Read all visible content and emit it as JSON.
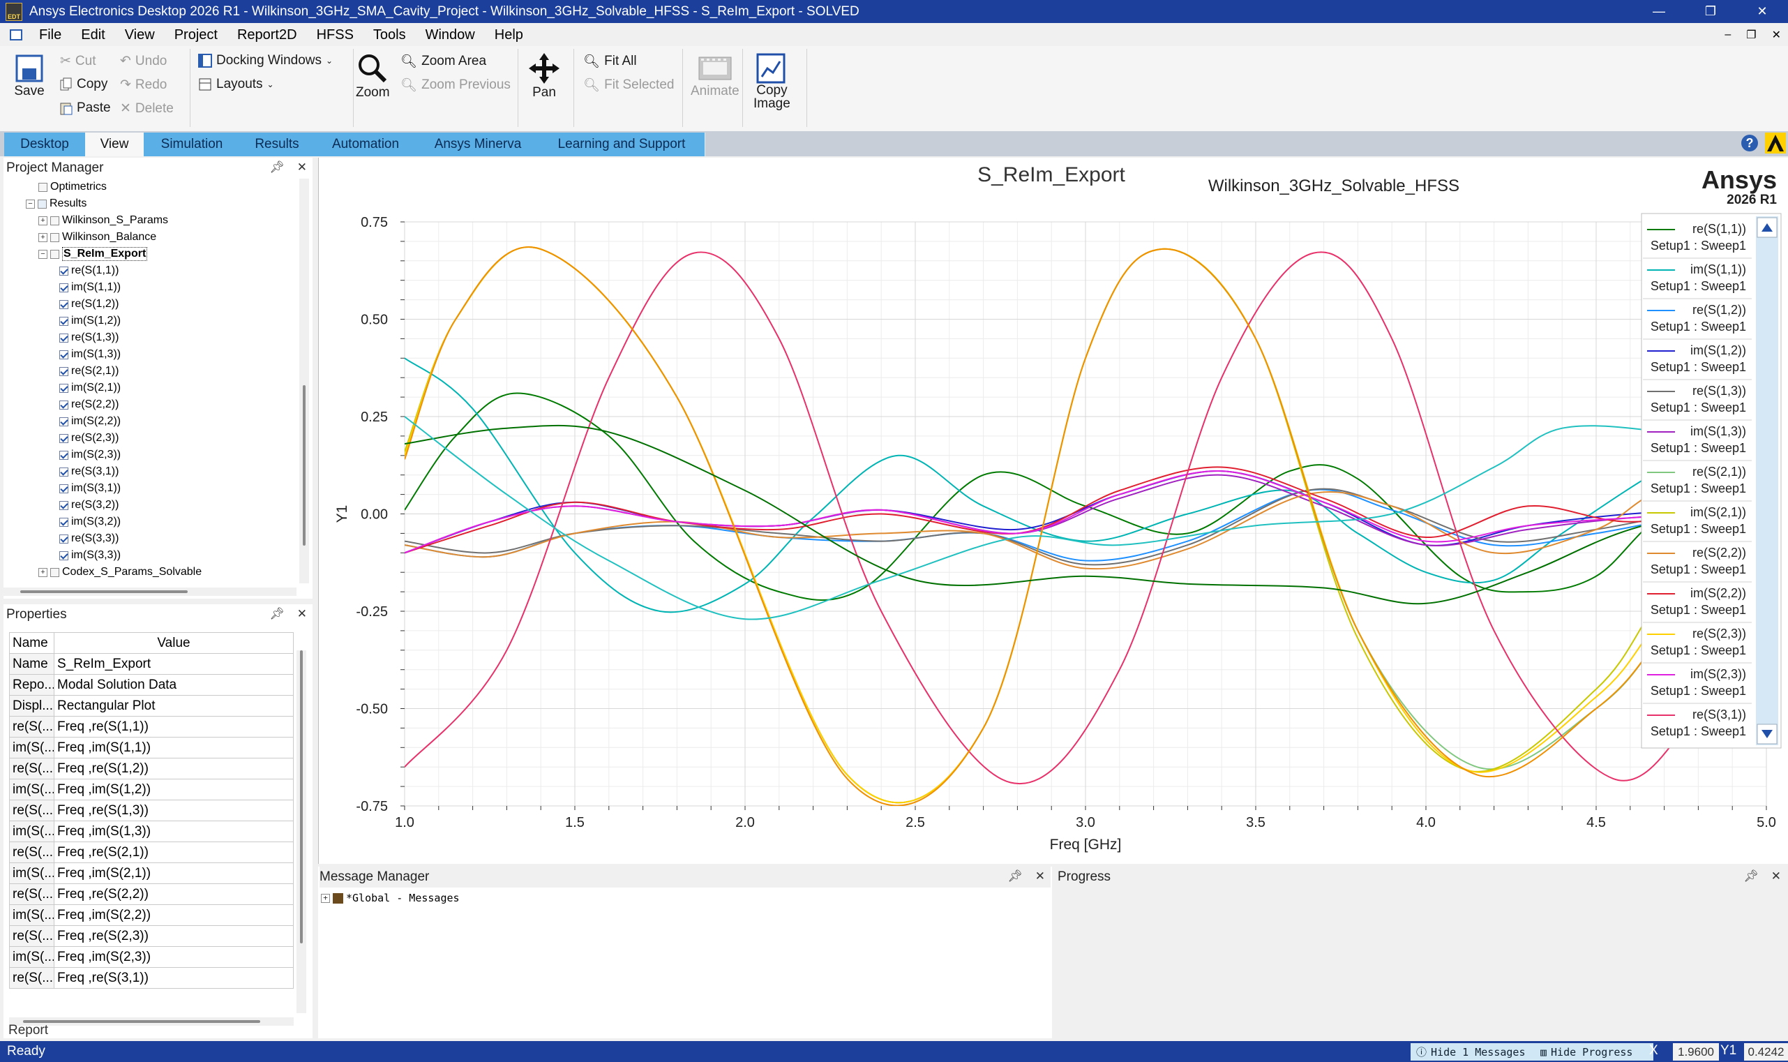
{
  "window": {
    "title": "Ansys Electronics Desktop 2026 R1 - Wilkinson_3GHz_SMA_Cavity_Project - Wilkinson_3GHz_Solvable_HFSS - S_ReIm_Export - SOLVED",
    "app_icon_text": "EDT",
    "controls": [
      "—",
      "❐",
      "✕"
    ]
  },
  "menu": {
    "items": [
      "File",
      "Edit",
      "View",
      "Project",
      "Report2D",
      "HFSS",
      "Tools",
      "Window",
      "Help"
    ],
    "mdi_controls": [
      "–",
      "❐",
      "✕"
    ]
  },
  "ribbon": {
    "save": "Save",
    "cut": "Cut",
    "copy": "Copy",
    "paste": "Paste",
    "undo": "Undo",
    "redo": "Redo",
    "delete": "Delete",
    "docking_windows": "Docking Windows",
    "layouts": "Layouts",
    "zoom": "Zoom",
    "zoom_area": "Zoom Area",
    "zoom_previous": "Zoom Previous",
    "pan": "Pan",
    "fit_all": "Fit All",
    "fit_selected": "Fit Selected",
    "animate": "Animate",
    "copy_image_line1": "Copy",
    "copy_image_line2": "Image"
  },
  "tabs": [
    "Desktop",
    "View",
    "Simulation",
    "Results",
    "Automation",
    "Ansys Minerva",
    "Learning and Support"
  ],
  "active_tab": "View",
  "project_manager": {
    "title": "Project Manager",
    "tree": [
      {
        "label": "Optimetrics",
        "level": 3,
        "exp": "",
        "icon": "optimetrics"
      },
      {
        "label": "Results",
        "level": 2,
        "exp": "−",
        "icon": "results"
      },
      {
        "label": "Wilkinson_S_Params",
        "level": 3,
        "exp": "+",
        "icon": "report"
      },
      {
        "label": "Wilkinson_Balance",
        "level": 3,
        "exp": "+",
        "icon": "report"
      },
      {
        "label": "S_ReIm_Export",
        "level": 3,
        "exp": "−",
        "icon": "report",
        "bold": true
      },
      {
        "label": "re(S(1,1))",
        "level": 4,
        "icon": "check"
      },
      {
        "label": "im(S(1,1))",
        "level": 4,
        "icon": "check"
      },
      {
        "label": "re(S(1,2))",
        "level": 4,
        "icon": "check"
      },
      {
        "label": "im(S(1,2))",
        "level": 4,
        "icon": "check"
      },
      {
        "label": "re(S(1,3))",
        "level": 4,
        "icon": "check"
      },
      {
        "label": "im(S(1,3))",
        "level": 4,
        "icon": "check"
      },
      {
        "label": "re(S(2,1))",
        "level": 4,
        "icon": "check"
      },
      {
        "label": "im(S(2,1))",
        "level": 4,
        "icon": "check"
      },
      {
        "label": "re(S(2,2))",
        "level": 4,
        "icon": "check"
      },
      {
        "label": "im(S(2,2))",
        "level": 4,
        "icon": "check"
      },
      {
        "label": "re(S(2,3))",
        "level": 4,
        "icon": "check"
      },
      {
        "label": "im(S(2,3))",
        "level": 4,
        "icon": "check"
      },
      {
        "label": "re(S(3,1))",
        "level": 4,
        "icon": "check"
      },
      {
        "label": "im(S(3,1))",
        "level": 4,
        "icon": "check"
      },
      {
        "label": "re(S(3,2))",
        "level": 4,
        "icon": "check"
      },
      {
        "label": "im(S(3,2))",
        "level": 4,
        "icon": "check"
      },
      {
        "label": "re(S(3,3))",
        "level": 4,
        "icon": "check"
      },
      {
        "label": "im(S(3,3))",
        "level": 4,
        "icon": "check"
      },
      {
        "label": "Codex_S_Params_Solvable",
        "level": 3,
        "exp": "+",
        "icon": "report"
      }
    ]
  },
  "properties": {
    "title": "Properties",
    "col_name": "Name",
    "col_value": "Value",
    "rows": [
      {
        "name": "Name",
        "value": "S_ReIm_Export"
      },
      {
        "name": "Repo...",
        "value": "Modal Solution Data"
      },
      {
        "name": "Displ...",
        "value": "Rectangular Plot"
      },
      {
        "name": "re(S(...",
        "value": "Freq ,re(S(1,1))"
      },
      {
        "name": "im(S(...",
        "value": "Freq ,im(S(1,1))"
      },
      {
        "name": "re(S(...",
        "value": "Freq ,re(S(1,2))"
      },
      {
        "name": "im(S(...",
        "value": "Freq ,im(S(1,2))"
      },
      {
        "name": "re(S(...",
        "value": "Freq ,re(S(1,3))"
      },
      {
        "name": "im(S(...",
        "value": "Freq ,im(S(1,3))"
      },
      {
        "name": "re(S(...",
        "value": "Freq ,re(S(2,1))"
      },
      {
        "name": "im(S(...",
        "value": "Freq ,im(S(2,1))"
      },
      {
        "name": "re(S(...",
        "value": "Freq ,re(S(2,2))"
      },
      {
        "name": "im(S(...",
        "value": "Freq ,im(S(2,2))"
      },
      {
        "name": "re(S(...",
        "value": "Freq ,re(S(2,3))"
      },
      {
        "name": "im(S(...",
        "value": "Freq ,im(S(2,3))"
      },
      {
        "name": "re(S(...",
        "value": "Freq ,re(S(3,1))"
      }
    ],
    "report_tab": "Report"
  },
  "chart_data": {
    "type": "line",
    "title": "S_ReIm_Export",
    "design_label": "Wilkinson_3GHz_Solvable_HFSS",
    "brand": "Ansys",
    "brand_version": "2026 R1",
    "xlabel": "Freq [GHz]",
    "ylabel": "Y1",
    "xlim": [
      1.0,
      5.0
    ],
    "ylim": [
      -0.75,
      0.75
    ],
    "xticks": [
      1.0,
      1.5,
      2.0,
      2.5,
      3.0,
      3.5,
      4.0,
      4.5,
      5.0
    ],
    "xtick_labels": [
      "1.0",
      "1.5",
      "2.0",
      "2.5",
      "3.0",
      "3.5",
      "4.0",
      "4.5",
      "5.0"
    ],
    "yticks": [
      0.75,
      0.5,
      0.25,
      0.0,
      -0.25,
      -0.5,
      -0.75
    ],
    "ytick_labels": [
      "0.75",
      "0.50",
      "0.25",
      "0.00",
      "-0.25",
      "-0.50",
      "-0.75"
    ],
    "grid": true,
    "legend_position": "right",
    "legend_sweep_label": "Setup1 : Sweep1",
    "series": [
      {
        "name": "re(S(1,1))",
        "color": "#007a00",
        "x": [
          1.0,
          1.15,
          1.33,
          1.6,
          1.85,
          2.1,
          2.35,
          2.7,
          3.0,
          3.3,
          3.6,
          3.8,
          4.1,
          4.3,
          4.5,
          4.7,
          5.0
        ],
        "y": [
          0.01,
          0.2,
          0.31,
          0.2,
          -0.07,
          -0.2,
          -0.19,
          0.1,
          0.02,
          -0.05,
          0.11,
          0.09,
          -0.16,
          -0.2,
          -0.16,
          0.0,
          0.1
        ]
      },
      {
        "name": "im(S(1,1))",
        "color": "#00b4b4",
        "x": [
          1.0,
          1.2,
          1.5,
          1.75,
          2.0,
          2.2,
          2.45,
          2.7,
          3.0,
          3.3,
          3.6,
          3.8,
          4.0,
          4.2,
          4.4,
          4.7,
          5.0
        ],
        "y": [
          0.4,
          0.27,
          -0.1,
          -0.25,
          -0.18,
          -0.01,
          0.15,
          0.02,
          -0.07,
          0.0,
          0.06,
          -0.05,
          -0.15,
          -0.17,
          -0.05,
          0.12,
          0.25
        ]
      },
      {
        "name": "re(S(1,2))",
        "color": "#1e90ff",
        "x": [
          1.0,
          1.25,
          1.5,
          1.8,
          2.1,
          2.4,
          2.7,
          3.0,
          3.3,
          3.65,
          3.9,
          4.2,
          4.5,
          4.8,
          5.0
        ],
        "y": [
          -0.08,
          -0.11,
          -0.05,
          -0.03,
          -0.06,
          -0.07,
          -0.05,
          -0.12,
          -0.07,
          0.06,
          0.01,
          -0.08,
          -0.05,
          0.0,
          0.02
        ]
      },
      {
        "name": "im(S(1,2))",
        "color": "#2020d0",
        "x": [
          1.0,
          1.25,
          1.5,
          1.8,
          2.1,
          2.4,
          2.8,
          3.1,
          3.4,
          3.7,
          4.0,
          4.3,
          4.6,
          5.0
        ],
        "y": [
          -0.1,
          -0.02,
          0.03,
          -0.02,
          -0.03,
          0.01,
          -0.04,
          0.05,
          0.11,
          0.03,
          -0.08,
          -0.03,
          0.0,
          0.02
        ]
      },
      {
        "name": "re(S(1,3))",
        "color": "#707070",
        "x": [
          1.0,
          1.25,
          1.5,
          1.8,
          2.1,
          2.4,
          2.7,
          3.0,
          3.3,
          3.65,
          3.9,
          4.2,
          4.5,
          4.8,
          5.0
        ],
        "y": [
          -0.07,
          -0.1,
          -0.05,
          -0.03,
          -0.05,
          -0.07,
          -0.05,
          -0.13,
          -0.08,
          0.06,
          0.02,
          -0.07,
          -0.04,
          0.01,
          0.03
        ]
      },
      {
        "name": "im(S(1,3))",
        "color": "#a020c0",
        "x": [
          1.0,
          1.25,
          1.5,
          1.8,
          2.1,
          2.4,
          2.8,
          3.1,
          3.4,
          3.7,
          4.0,
          4.3,
          4.6,
          5.0
        ],
        "y": [
          -0.1,
          -0.02,
          0.02,
          -0.02,
          -0.03,
          0.01,
          -0.05,
          0.04,
          0.1,
          0.02,
          -0.08,
          -0.04,
          -0.01,
          0.01
        ]
      },
      {
        "name": "re(S(2,1))",
        "color": "#80c880",
        "x": [
          1.0,
          1.15,
          1.4,
          1.8,
          2.3,
          2.7,
          3.0,
          3.22,
          3.5,
          3.8,
          4.15,
          4.5,
          4.7,
          5.0
        ],
        "y": [
          0.15,
          0.5,
          0.68,
          0.3,
          -0.67,
          -0.55,
          0.4,
          0.68,
          0.45,
          -0.3,
          -0.65,
          -0.5,
          -0.3,
          0.1
        ]
      },
      {
        "name": "im(S(2,1))",
        "color": "#c8c800",
        "x": [
          1.0,
          1.15,
          1.4,
          1.8,
          2.3,
          2.7,
          3.0,
          3.22,
          3.5,
          3.8,
          4.13,
          4.5,
          4.7,
          5.0
        ],
        "y": [
          0.16,
          0.5,
          0.68,
          0.3,
          -0.67,
          -0.55,
          0.4,
          0.68,
          0.45,
          -0.32,
          -0.66,
          -0.45,
          -0.2,
          0.15
        ]
      },
      {
        "name": "re(S(2,2))",
        "color": "#e08a30",
        "x": [
          1.0,
          1.25,
          1.5,
          1.8,
          2.1,
          2.4,
          2.7,
          3.0,
          3.3,
          3.65,
          3.9,
          4.2,
          4.5,
          4.7,
          5.0
        ],
        "y": [
          -0.08,
          -0.11,
          -0.05,
          -0.02,
          -0.06,
          -0.05,
          -0.05,
          -0.14,
          -0.09,
          0.05,
          0.02,
          -0.1,
          -0.04,
          0.06,
          0.05
        ]
      },
      {
        "name": "im(S(2,2))",
        "color": "#e02030",
        "x": [
          1.0,
          1.25,
          1.5,
          1.8,
          2.1,
          2.4,
          2.8,
          3.1,
          3.4,
          3.7,
          4.0,
          4.3,
          4.6,
          5.0
        ],
        "y": [
          -0.1,
          -0.03,
          0.03,
          -0.02,
          -0.04,
          0.0,
          -0.05,
          0.06,
          0.12,
          0.04,
          -0.06,
          0.02,
          -0.02,
          0.02
        ]
      },
      {
        "name": "re(S(2,3))",
        "color": "#ffd000",
        "x": [
          1.0,
          1.15,
          1.4,
          1.8,
          2.3,
          2.7,
          3.0,
          3.22,
          3.5,
          3.8,
          4.13,
          4.5,
          4.7,
          5.0
        ],
        "y": [
          0.15,
          0.5,
          0.68,
          0.3,
          -0.67,
          -0.55,
          0.4,
          0.68,
          0.45,
          -0.3,
          -0.66,
          -0.47,
          -0.25,
          0.12
        ]
      },
      {
        "name": "im(S(2,3))",
        "color": "#e020e0",
        "x": [
          1.0,
          1.25,
          1.5,
          1.8,
          2.1,
          2.4,
          2.8,
          3.1,
          3.4,
          3.7,
          4.0,
          4.3,
          4.6,
          5.0
        ],
        "y": [
          -0.1,
          -0.02,
          0.02,
          -0.02,
          -0.03,
          0.01,
          -0.05,
          0.05,
          0.11,
          0.03,
          -0.07,
          -0.03,
          -0.01,
          0.01
        ]
      },
      {
        "name": "re(S(3,1))",
        "color": "#e8306a",
        "x": [
          1.0,
          1.3,
          1.6,
          1.85,
          2.1,
          2.4,
          2.78,
          3.1,
          3.4,
          3.67,
          3.9,
          4.2,
          4.55,
          4.8,
          5.0
        ],
        "y": [
          -0.65,
          -0.35,
          0.35,
          0.67,
          0.45,
          -0.25,
          -0.69,
          -0.4,
          0.35,
          0.67,
          0.45,
          -0.3,
          -0.68,
          -0.5,
          -0.2
        ]
      },
      {
        "name": "im(S(3,1))",
        "color": "#f09000",
        "x": [
          1.0,
          1.15,
          1.4,
          1.8,
          2.3,
          2.7,
          3.0,
          3.22,
          3.5,
          3.8,
          4.15,
          4.5,
          4.7,
          5.0
        ],
        "y": [
          0.14,
          0.5,
          0.68,
          0.3,
          -0.68,
          -0.55,
          0.4,
          0.68,
          0.45,
          -0.3,
          -0.67,
          -0.5,
          -0.3,
          0.1
        ]
      },
      {
        "name": "re(S(3,3))",
        "color": "#007000",
        "x": [
          1.0,
          1.3,
          1.6,
          2.0,
          2.5,
          3.0,
          3.3,
          3.7,
          4.0,
          4.3,
          4.6,
          5.0
        ],
        "y": [
          0.18,
          0.22,
          0.21,
          0.06,
          -0.17,
          -0.16,
          -0.18,
          -0.19,
          -0.23,
          -0.15,
          -0.04,
          0.04
        ]
      },
      {
        "name": "im(S(3,3))",
        "color": "#20c0c0",
        "x": [
          1.0,
          1.3,
          1.6,
          2.0,
          2.4,
          2.8,
          3.1,
          3.5,
          3.9,
          4.2,
          4.4,
          4.7,
          5.0
        ],
        "y": [
          0.25,
          0.05,
          -0.12,
          -0.27,
          -0.17,
          -0.06,
          -0.08,
          -0.03,
          0.0,
          0.12,
          0.22,
          0.21,
          0.16
        ]
      }
    ],
    "legend_entries": [
      "re(S(1,1))",
      "im(S(1,1))",
      "re(S(1,2))",
      "im(S(1,2))",
      "re(S(1,3))",
      "im(S(1,3))",
      "re(S(2,1))",
      "im(S(2,1))",
      "re(S(2,2))",
      "im(S(2,2))",
      "re(S(2,3))",
      "im(S(2,3))",
      "re(S(3,1))"
    ]
  },
  "message_manager": {
    "title": "Message Manager",
    "row": "*Global - Messages"
  },
  "progress": {
    "title": "Progress"
  },
  "status": {
    "text": "Ready",
    "hide_messages": "Hide 1 Messages",
    "hide_progress": "Hide Progress",
    "x_label": "X",
    "x_value": "1.9600",
    "y_label": "Y1",
    "y_value": "0.4242"
  },
  "colors": {
    "titlebar": "#1b3f9a",
    "tab_blue": "#5ab0e6",
    "statusbar": "#1b3f9a"
  }
}
